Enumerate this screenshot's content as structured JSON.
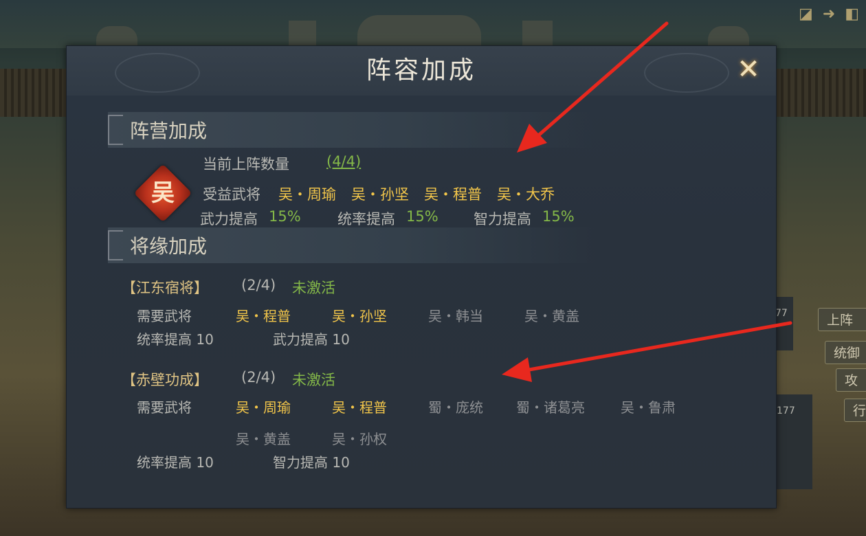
{
  "panel": {
    "title": "阵容加成",
    "close_icon": "✕"
  },
  "camp": {
    "section_title": "阵营加成",
    "faction": "吴",
    "count_label": "当前上阵数量",
    "count_value": "(4/4)",
    "benefit_label": "受益武将",
    "generals": [
      "吴・周瑜",
      "吴・孙坚",
      "吴・程普",
      "吴・大乔"
    ],
    "bonuses": [
      {
        "label": "武力提高",
        "value": "15%"
      },
      {
        "label": "统率提高",
        "value": "15%"
      },
      {
        "label": "智力提高",
        "value": "15%"
      }
    ]
  },
  "bond": {
    "section_title": "将缘加成",
    "groups": [
      {
        "name": "【江东宿将】",
        "progress": "(2/4)",
        "status": "未激活",
        "need_label": "需要武将",
        "members_active": [
          "吴・程普",
          "吴・孙坚"
        ],
        "members_inactive": [
          "吴・韩当",
          "吴・黄盖"
        ],
        "bonuses": [
          "统率提高 10",
          "武力提高 10"
        ]
      },
      {
        "name": "【赤壁功成】",
        "progress": "(2/4)",
        "status": "未激活",
        "need_label": "需要武将",
        "members_active": [
          "吴・周瑜",
          "吴・程普"
        ],
        "members_inactive": [
          "蜀・庞统",
          "蜀・诸葛亮",
          "吴・鲁肃",
          "吴・黄盖",
          "吴・孙权"
        ],
        "bonuses": [
          "统率提高 10",
          "智力提高 10"
        ]
      }
    ]
  },
  "background": {
    "side_buttons": [
      "上阵",
      "统御",
      "攻",
      "行"
    ],
    "side_numbers": [
      "77",
      "177"
    ],
    "top_icons": [
      "◪",
      "➜",
      "◧"
    ]
  },
  "colors": {
    "accent_gold": "#f3c64a",
    "status_green": "#84b848",
    "inactive_grey": "#8d8f92",
    "arrow_red": "#e8281e"
  }
}
